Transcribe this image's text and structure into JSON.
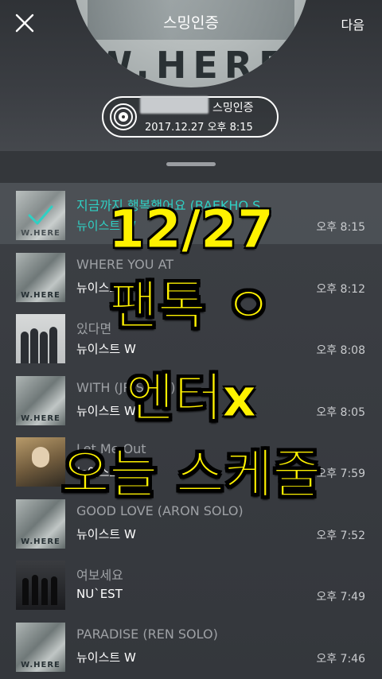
{
  "header": {
    "title": "스밍인증",
    "next_label": "다음",
    "album_text": "W.HERE"
  },
  "badge": {
    "label": "스밍인증",
    "timestamp": "2017.12.27 오후 8:15"
  },
  "tracks": [
    {
      "song": "지금까지 행복했어요 (BAEKHO S...",
      "artist": "뉴이스트 W",
      "time": "오후 8:15",
      "active": true,
      "art": "where"
    },
    {
      "song": "WHERE YOU AT",
      "artist": "뉴이스트 W",
      "time": "오후 8:12",
      "active": false,
      "art": "where"
    },
    {
      "song": "있다면",
      "artist": "뉴이스트 W",
      "time": "오후 8:08",
      "active": false,
      "art": "group"
    },
    {
      "song": "WITH (JR SOLO)",
      "artist": "뉴이스트 W",
      "time": "오후 8:05",
      "active": false,
      "art": "where"
    },
    {
      "song": "Let Me Out",
      "artist": "뉴이스트 W",
      "time": "오후 7:59",
      "active": false,
      "art": "movie"
    },
    {
      "song": "GOOD LOVE (ARON SOLO)",
      "artist": "뉴이스트 W",
      "time": "오후 7:52",
      "active": false,
      "art": "where"
    },
    {
      "song": "여보세요",
      "artist": "NU`EST",
      "time": "오후 7:49",
      "active": false,
      "art": "dark"
    },
    {
      "song": "PARADISE (REN SOLO)",
      "artist": "뉴이스트 W",
      "time": "오후 7:46",
      "active": false,
      "art": "where"
    }
  ],
  "overlay_text": {
    "line1": "12/27",
    "line2": "팬톡 ㅇ",
    "line3": "엔터x",
    "line4": "오늘 스케줄"
  },
  "colors": {
    "accent_teal": "#2fd0c4",
    "overlay_yellow": "#fff200"
  }
}
